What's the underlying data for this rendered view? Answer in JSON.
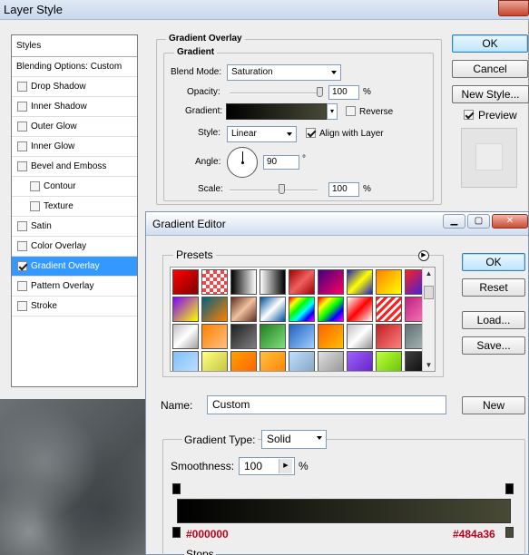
{
  "layer_style": {
    "title": "Layer Style",
    "styles_header": "Styles",
    "items": [
      {
        "label": "Blending Options: Custom",
        "checkbox": false,
        "checked": false,
        "sub": false,
        "selected": false
      },
      {
        "label": "Drop Shadow",
        "checkbox": true,
        "checked": false,
        "sub": false,
        "selected": false
      },
      {
        "label": "Inner Shadow",
        "checkbox": true,
        "checked": false,
        "sub": false,
        "selected": false
      },
      {
        "label": "Outer Glow",
        "checkbox": true,
        "checked": false,
        "sub": false,
        "selected": false
      },
      {
        "label": "Inner Glow",
        "checkbox": true,
        "checked": false,
        "sub": false,
        "selected": false
      },
      {
        "label": "Bevel and Emboss",
        "checkbox": true,
        "checked": false,
        "sub": false,
        "selected": false
      },
      {
        "label": "Contour",
        "checkbox": true,
        "checked": false,
        "sub": true,
        "selected": false
      },
      {
        "label": "Texture",
        "checkbox": true,
        "checked": false,
        "sub": true,
        "selected": false
      },
      {
        "label": "Satin",
        "checkbox": true,
        "checked": false,
        "sub": false,
        "selected": false
      },
      {
        "label": "Color Overlay",
        "checkbox": true,
        "checked": false,
        "sub": false,
        "selected": false
      },
      {
        "label": "Gradient Overlay",
        "checkbox": true,
        "checked": true,
        "sub": false,
        "selected": true
      },
      {
        "label": "Pattern Overlay",
        "checkbox": true,
        "checked": false,
        "sub": false,
        "selected": false
      },
      {
        "label": "Stroke",
        "checkbox": true,
        "checked": false,
        "sub": false,
        "selected": false
      }
    ],
    "section_title": "Gradient Overlay",
    "group_title": "Gradient",
    "blend_mode_label": "Blend Mode:",
    "blend_mode_value": "Saturation",
    "opacity_label": "Opacity:",
    "opacity_value": "100",
    "opacity_fraction": 1.0,
    "percent": "%",
    "gradient_label": "Gradient:",
    "reverse_label": "Reverse",
    "style_label": "Style:",
    "style_value": "Linear",
    "align_label": "Align with Layer",
    "angle_label": "Angle:",
    "angle_value": "90",
    "degree": "°",
    "scale_label": "Scale:",
    "scale_value": "100",
    "scale_fraction": 0.6,
    "ok": "OK",
    "cancel": "Cancel",
    "new_style": "New Style...",
    "preview_label": "Preview"
  },
  "gradient_editor": {
    "title": "Gradient Editor",
    "presets_label": "Presets",
    "ok": "OK",
    "reset": "Reset",
    "load": "Load...",
    "save": "Save...",
    "name_label": "Name:",
    "name_value": "Custom",
    "new": "New",
    "gradient_type_label": "Gradient Type:",
    "gradient_type_value": "Solid",
    "smoothness_label": "Smoothness:",
    "smoothness_value": "100",
    "percent": "%",
    "stop_left_color": "#000000",
    "stop_right_color": "#484a36",
    "stops_label": "Stops",
    "gradient_start": "#000000",
    "gradient_end": "#484a36"
  },
  "colors": {
    "selection": "#3399ff",
    "stop_text": "#c0001a"
  },
  "swatches": [
    [
      "linear-gradient(135deg,#ff0000,#800000)",
      "repeating-conic-gradient(#ff4040 0 25%,#fff 0 50%) 0 0/8px 8px",
      "linear-gradient(to right,#000,#fff)",
      "linear-gradient(to right,#fff,#000)",
      "linear-gradient(135deg,#a00000,#f06060,#a00000)",
      "linear-gradient(135deg,#400080,#ff0060)",
      "linear-gradient(135deg,#2020c0,#ffff00,#2020c0)",
      "linear-gradient(135deg,#ff8000,#ffff00)",
      "linear-gradient(135deg,#ff2020,#2020ff)"
    ],
    [
      "linear-gradient(135deg,#8000ff,#ffff00)",
      "linear-gradient(135deg,#006080,#ff8000)",
      "linear-gradient(135deg,#603020,#f0c0a0,#603020)",
      "linear-gradient(135deg,#0050a0,#fff,#0050a0)",
      "linear-gradient(135deg,#ff0000,#ffff00,#00ff00,#00ffff,#0000ff,#ff00ff)",
      "linear-gradient(135deg,#ff0000,#ffff00,#00ff00,#0000ff,#ff00ff)",
      "linear-gradient(135deg,transparent,#ff0000,transparent)",
      "repeating-linear-gradient(135deg,#ff2020 0 3px,#fff 3px 6px)",
      "linear-gradient(135deg,#c02080,#ff80c0)"
    ],
    [
      "linear-gradient(135deg,#c0c0c0,#fff,#a0a0a0)",
      "linear-gradient(135deg,#ff8000,#ffc080)",
      "linear-gradient(135deg,#202020,#808080)",
      "linear-gradient(135deg,#208020,#80e080)",
      "linear-gradient(135deg,#2060c0,#a0d0ff)",
      "linear-gradient(135deg,#ff6000,#ffc000)",
      "linear-gradient(135deg,#c0c0c0,#fff,#909090)",
      "linear-gradient(135deg,#c02020,#ff8080)",
      "linear-gradient(135deg,#607070,#b0c0c0)"
    ],
    [
      "linear-gradient(135deg,#80c0ff,#c0e0ff)",
      "linear-gradient(135deg,#ffff80,#c0c040)",
      "linear-gradient(135deg,#ffa000,#ff6000)",
      "linear-gradient(135deg,#ffc040,#ff8000)",
      "linear-gradient(135deg,#c0e0ff,#80a0c0)",
      "linear-gradient(135deg,#e0e0e0,#909090)",
      "linear-gradient(135deg,#a060ff,#6020c0)",
      "linear-gradient(135deg,#c0ff40,#60c000)",
      "linear-gradient(135deg,#404040,#000)"
    ]
  ]
}
